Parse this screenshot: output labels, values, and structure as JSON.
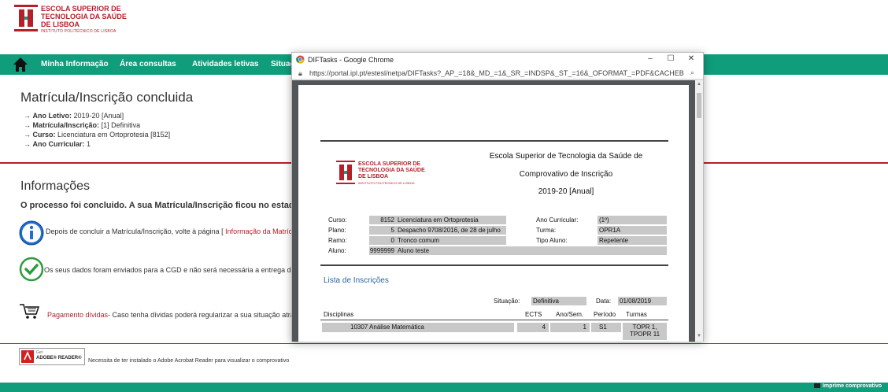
{
  "logo": {
    "line1": "ESCOLA SUPERIOR DE",
    "line2": "TECNOLOGIA DA SAÚDE",
    "line3": "DE LISBOA",
    "sub": "INSTITUTO POLITÉCNICO DE LISBOA"
  },
  "nav": {
    "items": [
      "Minha Informação",
      "Área consultas",
      "Atividades letivas",
      "Situaç"
    ]
  },
  "main": {
    "title": "Matrícula/Inscrição concluida",
    "info": [
      {
        "label": "Ano Letivo:",
        "value": "2019-20 [Anual]"
      },
      {
        "label": "Matrícula/Inscrição:",
        "value": "[1] Definitiva"
      },
      {
        "label": "Curso:",
        "value": "Licenciatura em Ortoprotesia [8152]"
      },
      {
        "label": "Ano Curricular:",
        "value": "1"
      }
    ],
    "section_title": "Informações",
    "status_line": "O processo foi concluido. A sua Matrícula/Inscrição ficou no estado  De",
    "row1_text": "Depois de concluir a Matrícula/Inscrição, volte à página [",
    "row1_link": " Informação da Matrícula/In",
    "row2_text": "Os seus dados foram enviados para a CGD e não será necessária a entrega do Mo",
    "row3_link": "Pagamento dívidas",
    "row3_text": "- Caso tenha dívidas poderá regularizar a sua situação através d"
  },
  "adobe": {
    "badge_get": "Get",
    "badge_name": "ADOBE® READER®",
    "text": "Necessita de ter instalado o Adobe Acrobat Reader para visualizar o comprovativo"
  },
  "footer": {
    "button": "Imprime comprovativo"
  },
  "popup": {
    "title": "DIFTasks - Google Chrome",
    "url": "https://portal.ipl.pt/estesl/netpa/DIFTasks?_AP_=18&_MD_=1&_SR_=INDSP&_ST_=16&_OFORMAT_=PDF&CACHEB...",
    "doc": {
      "header1": "Escola Superior de Tecnologia da Saúde de",
      "header2": "Comprovativo de Inscrição",
      "header3": "2019-20 [Anual]",
      "curso_label": "Curso:",
      "curso_num": "8152",
      "curso_val": "Licenciatura em Ortoprotesia",
      "plano_label": "Plano:",
      "plano_num": "5",
      "plano_val": "Despacho 9708/2016, de 28 de julho",
      "ramo_label": "Ramo:",
      "ramo_num": "0",
      "ramo_val": "Tronco comum",
      "aluno_label": "Aluno:",
      "aluno_num": "9999999",
      "aluno_val": "Aluno teste",
      "ano_label": "Ano Curricular:",
      "ano_val": "(1º)",
      "turma_label": "Turma:",
      "turma_val": "OPR1A",
      "tipo_label": "Tipo Aluno:",
      "tipo_val": "Repetente",
      "lista_title": "Lista de Inscrições",
      "situacao_label": "Situação:",
      "situacao_val": "Definitiva",
      "data_label": "Data:",
      "data_val": "01/08/2019",
      "col_disc": "Disciplinas",
      "col_ects": "ECTS",
      "col_ano": "Ano/Sem.",
      "col_periodo": "Período",
      "col_turmas": "Turmas",
      "row_code": "10307",
      "row_name": "Análise Matemática",
      "row_ects": "4",
      "row_ano": "1",
      "row_periodo": "S1",
      "row_turmas1": "TOPR 1,",
      "row_turmas2": "TPOPR 11"
    }
  }
}
